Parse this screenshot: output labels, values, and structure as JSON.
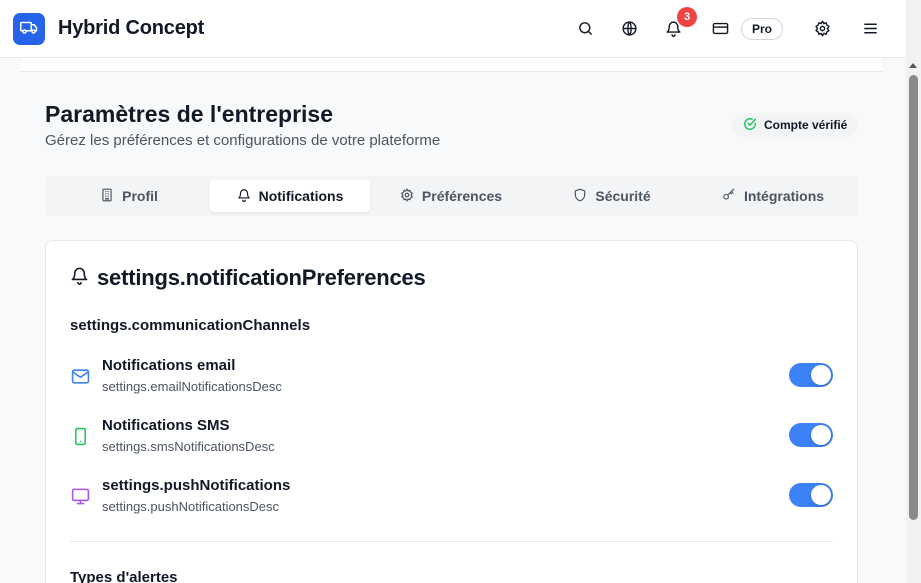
{
  "header": {
    "app_title": "Hybrid Concept",
    "notification_count": "3",
    "plan_badge": "Pro",
    "icons": [
      "truck-icon",
      "search-icon",
      "globe-icon",
      "bell-icon",
      "credit-card-icon",
      "gear-icon",
      "menu-icon"
    ]
  },
  "page": {
    "title": "Paramètres de l'entreprise",
    "subtitle": "Gérez les préférences et configurations de votre plateforme",
    "verified_label": "Compte vérifié"
  },
  "tabs": [
    {
      "label": "Profil",
      "icon": "building-icon",
      "active": false
    },
    {
      "label": "Notifications",
      "icon": "bell-icon",
      "active": true
    },
    {
      "label": "Préférences",
      "icon": "gear-icon",
      "active": false
    },
    {
      "label": "Sécurité",
      "icon": "shield-icon",
      "active": false
    },
    {
      "label": "Intégrations",
      "icon": "key-icon",
      "active": false
    }
  ],
  "card": {
    "title": "settings.notificationPreferences",
    "section_label": "settings.communicationChannels",
    "channels": [
      {
        "title": "Notifications email",
        "desc": "settings.emailNotificationsDesc",
        "icon": "mail-icon",
        "enabled": true
      },
      {
        "title": "Notifications SMS",
        "desc": "settings.smsNotificationsDesc",
        "icon": "smartphone-icon",
        "enabled": true
      },
      {
        "title": "settings.pushNotifications",
        "desc": "settings.pushNotificationsDesc",
        "icon": "monitor-icon",
        "enabled": true
      }
    ],
    "alert_types_label": "Types d'alertes"
  },
  "colors": {
    "accent": "#2563eb",
    "toggle_on": "#3b82f6",
    "badge": "#ef4444",
    "verified_check": "#22c55e",
    "mail_icon": "#3b82f6",
    "sms_icon": "#22c55e",
    "push_icon": "#a855f7"
  }
}
